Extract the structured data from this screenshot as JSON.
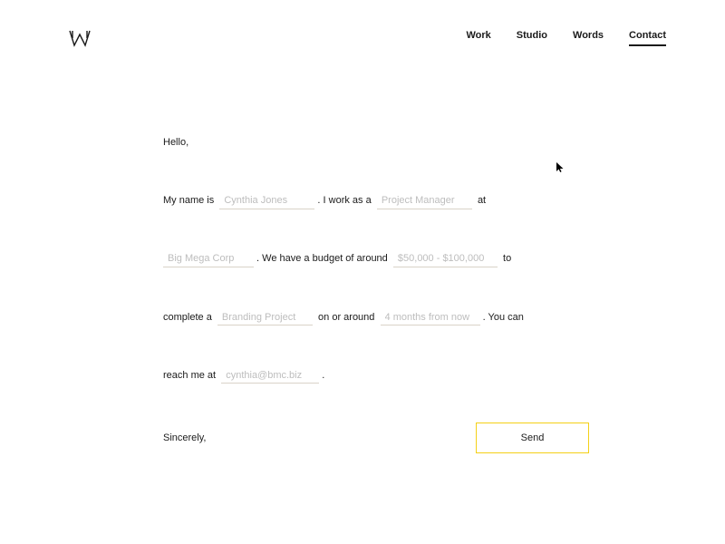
{
  "nav": {
    "items": [
      {
        "label": "Work",
        "name": "nav-work",
        "active": false
      },
      {
        "label": "Studio",
        "name": "nav-studio",
        "active": false
      },
      {
        "label": "Words",
        "name": "nav-words",
        "active": false
      },
      {
        "label": "Contact",
        "name": "nav-contact",
        "active": true
      }
    ]
  },
  "form": {
    "greeting": "Hello,",
    "t_my_name_is": "My name is  ",
    "name_placeholder": "Cynthia Jones",
    "t_i_work_as": " . I work as a  ",
    "role_placeholder": "Project Manager",
    "t_at": "  at",
    "company_placeholder": "Big Mega Corp",
    "t_budget": " . We have a budget of around  ",
    "budget_placeholder": "$50,000 - $100,000",
    "t_to": "  to",
    "t_complete": "complete a  ",
    "project_placeholder": "Branding Project",
    "t_on_or_around": "  on or around  ",
    "timeline_placeholder": "4 months from now",
    "t_you_can": " . You can",
    "t_reach": "reach me at  ",
    "email_placeholder": "cynthia@bmc.biz",
    "t_period": " .",
    "signoff": "Sincerely,",
    "send_label": "Send"
  }
}
